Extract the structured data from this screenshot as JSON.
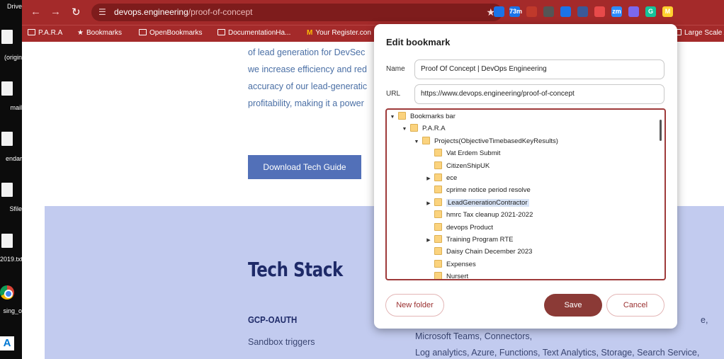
{
  "desktop": {
    "labels": [
      "Drive",
      "(origin",
      "mail",
      "endar",
      "Sfile",
      "2019.txt",
      "sing_o",
      ""
    ]
  },
  "browser": {
    "url_domain": "devops.engineering",
    "url_path": "/proof-of-concept",
    "extensions": [
      {
        "name": "calendar-extension-icon",
        "text": "",
        "color": "#1a73e8"
      },
      {
        "name": "badge-extension-icon",
        "text": "73m",
        "color": "#1a73e8"
      },
      {
        "name": "extension-icon-3",
        "text": "",
        "color": "#c0392b"
      },
      {
        "name": "extension-icon-4",
        "text": "",
        "color": "#555555"
      },
      {
        "name": "extension-icon-5",
        "text": "",
        "color": "#1a73e8"
      },
      {
        "name": "extension-icon-6",
        "text": "",
        "color": "#3b5998"
      },
      {
        "name": "extension-icon-7",
        "text": "",
        "color": "#e84a4a"
      },
      {
        "name": "zoom-extension-icon",
        "text": "zm",
        "color": "#2d8cff"
      },
      {
        "name": "extension-icon-9",
        "text": "",
        "color": "#7b68ee"
      },
      {
        "name": "grammarly-extension-icon",
        "text": "G",
        "color": "#15c39a"
      },
      {
        "name": "miro-extension-icon",
        "text": "M",
        "color": "#ffd02f"
      }
    ]
  },
  "bookmarks_bar": [
    {
      "label": "P.A.R.A",
      "icon": "folder-icon"
    },
    {
      "label": "Bookmarks",
      "icon": "star-icon"
    },
    {
      "label": "OpenBookmarks",
      "icon": "folder-icon"
    },
    {
      "label": "DocumentationHa...",
      "icon": "folder-icon"
    },
    {
      "label": "Your Register.con",
      "icon": "gmail-icon"
    },
    {
      "label": "Large Scale A",
      "icon": "folder-icon"
    }
  ],
  "page": {
    "paragraph": [
      "of lead generation for DevSec",
      "we increase efficiency and red",
      "accuracy of our lead-generatic",
      "profitability, making it a power"
    ],
    "download_button": "Download Tech Guide",
    "tech_title": "Tech Stack",
    "gcp_heading": "GCP-OAUTH",
    "sandbox_text": "Sandbox triggers",
    "right_col": [
      "Microsoft Teams, Connectors,",
      "Log analytics, Azure, Functions, Text Analytics, Storage, Search Service,"
    ],
    "cut_text": "e,"
  },
  "dialog": {
    "title": "Edit bookmark",
    "name_label": "Name",
    "name_value": "Proof Of Concept | DevOps Engineering",
    "url_label": "URL",
    "url_value": "https://www.devops.engineering/proof-of-concept",
    "tree": [
      {
        "label": "Bookmarks bar",
        "depth": 0,
        "toggle": "expanded",
        "selected": false
      },
      {
        "label": "P.A.R.A",
        "depth": 1,
        "toggle": "expanded",
        "selected": false
      },
      {
        "label": "Projects(ObjectiveTimebasedKeyResults)",
        "depth": 2,
        "toggle": "expanded",
        "selected": false
      },
      {
        "label": "Vat Erdem Submit",
        "depth": 3,
        "toggle": "none",
        "selected": false
      },
      {
        "label": "CitizenShipUK",
        "depth": 3,
        "toggle": "none",
        "selected": false
      },
      {
        "label": "ece",
        "depth": 3,
        "toggle": "collapsed",
        "selected": false
      },
      {
        "label": "cprime notice period resolve",
        "depth": 3,
        "toggle": "none",
        "selected": false
      },
      {
        "label": "LeadGenerationContractor",
        "depth": 3,
        "toggle": "collapsed",
        "selected": true
      },
      {
        "label": "hmrc Tax cleanup 2021-2022",
        "depth": 3,
        "toggle": "none",
        "selected": false
      },
      {
        "label": "devops Product",
        "depth": 3,
        "toggle": "none",
        "selected": false
      },
      {
        "label": "Training Program RTE",
        "depth": 3,
        "toggle": "collapsed",
        "selected": false
      },
      {
        "label": "Daisy Chain December 2023",
        "depth": 3,
        "toggle": "none",
        "selected": false
      },
      {
        "label": "Expenses",
        "depth": 3,
        "toggle": "none",
        "selected": false
      },
      {
        "label": "Nursert",
        "depth": 3,
        "toggle": "none",
        "selected": false
      }
    ],
    "new_folder_label": "New folder",
    "save_label": "Save",
    "cancel_label": "Cancel"
  }
}
